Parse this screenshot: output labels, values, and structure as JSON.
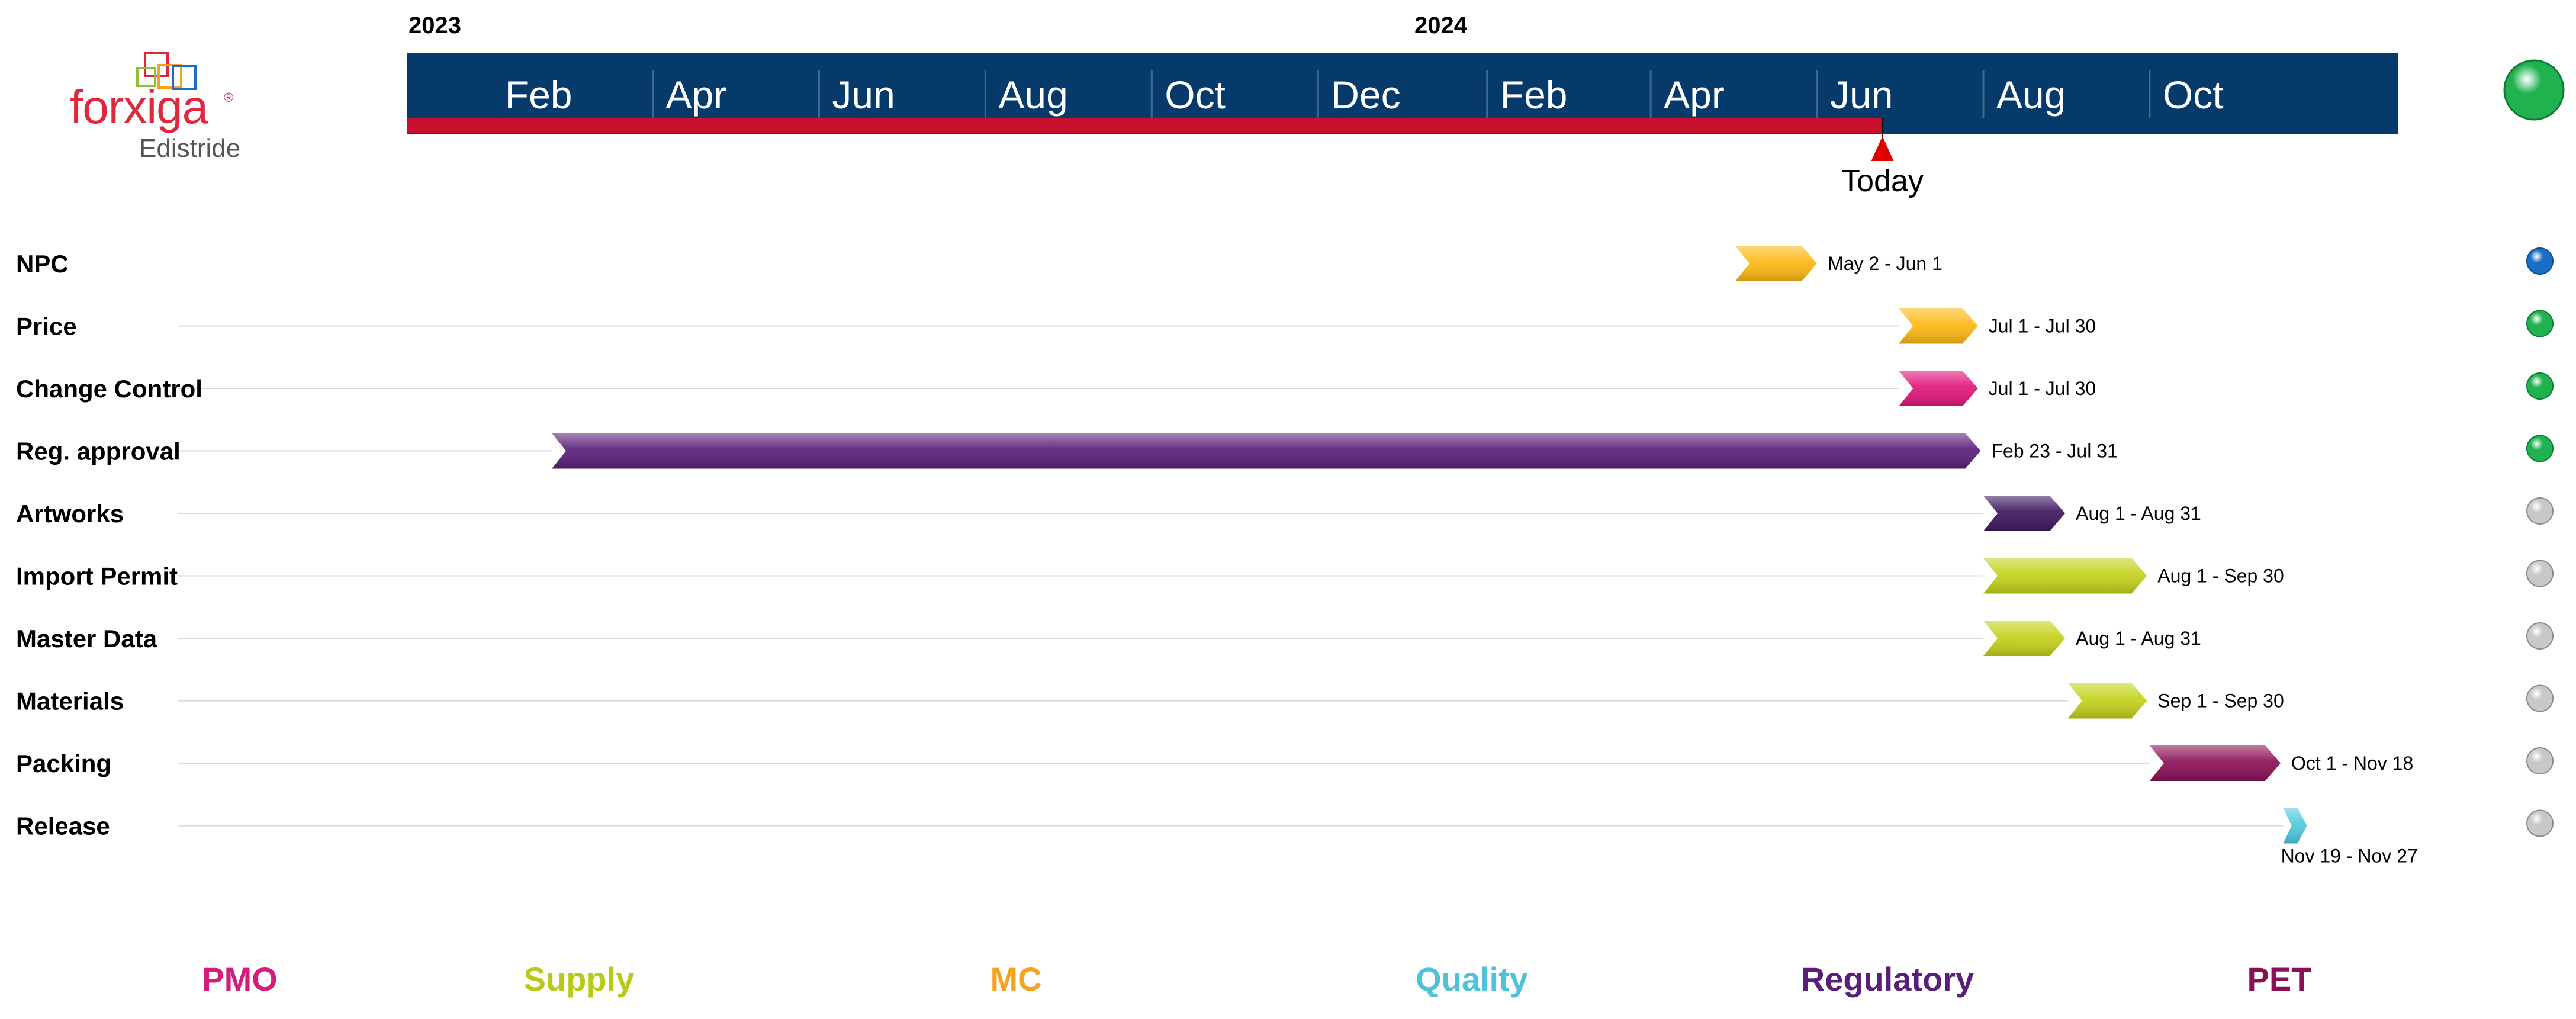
{
  "logo": {
    "name": "forxiga",
    "registered": "®",
    "subtitle": "Edistride"
  },
  "colors": {
    "timeline_band": "#063a6b",
    "progress_bar": "#c8102e",
    "today_marker": "#e00000",
    "gridline": "#d9d9d9"
  },
  "chart_data": {
    "type": "gantt",
    "years": [
      {
        "label": "2023",
        "date": "2023-01-01"
      },
      {
        "label": "2024",
        "date": "2024-01-01"
      }
    ],
    "axis": {
      "start": "2023-01-01",
      "end": "2024-12-31",
      "ticks": [
        {
          "label": "Feb",
          "date": "2023-02-01"
        },
        {
          "label": "Apr",
          "date": "2023-04-01"
        },
        {
          "label": "Jun",
          "date": "2023-06-01"
        },
        {
          "label": "Aug",
          "date": "2023-08-01"
        },
        {
          "label": "Oct",
          "date": "2023-10-01"
        },
        {
          "label": "Dec",
          "date": "2023-12-01"
        },
        {
          "label": "Feb",
          "date": "2024-02-01"
        },
        {
          "label": "Apr",
          "date": "2024-04-01"
        },
        {
          "label": "Jun",
          "date": "2024-06-01"
        },
        {
          "label": "Aug",
          "date": "2024-08-01"
        },
        {
          "label": "Oct",
          "date": "2024-10-01"
        }
      ]
    },
    "today": {
      "label": "Today",
      "date": "2024-06-25"
    },
    "tasks": [
      {
        "name": "NPC",
        "start": "2024-05-02",
        "end": "2024-06-01",
        "dates_label": "May 2 - Jun 1",
        "color": "#fdb913",
        "status_color": "#1a6fc4"
      },
      {
        "name": "Price",
        "start": "2024-07-01",
        "end": "2024-07-30",
        "dates_label": "Jul 1 - Jul 30",
        "color": "#fdb913",
        "status_color": "#1fb24f"
      },
      {
        "name": "Change Control",
        "start": "2024-07-01",
        "end": "2024-07-30",
        "dates_label": "Jul 1 - Jul 30",
        "color": "#e0157a",
        "status_color": "#1fb24f"
      },
      {
        "name": "Reg. approval",
        "start": "2023-02-23",
        "end": "2024-07-31",
        "dates_label": "Feb 23 - Jul 31",
        "color": "#5a1f7a",
        "status_color": "#1fb24f"
      },
      {
        "name": "Artworks",
        "start": "2024-08-01",
        "end": "2024-08-31",
        "dates_label": "Aug 1 - Aug 31",
        "color": "#3e1760",
        "status_color": "#c8c8c8"
      },
      {
        "name": "Import Permit",
        "start": "2024-08-01",
        "end": "2024-09-30",
        "dates_label": "Aug 1 - Sep 30",
        "color": "#c3d21a",
        "status_color": "#c8c8c8"
      },
      {
        "name": "Master Data",
        "start": "2024-08-01",
        "end": "2024-08-31",
        "dates_label": "Aug 1 - Aug 31",
        "color": "#c3d21a",
        "status_color": "#c8c8c8"
      },
      {
        "name": "Materials",
        "start": "2024-09-01",
        "end": "2024-09-30",
        "dates_label": "Sep 1 - Sep 30",
        "color": "#c3d21a",
        "status_color": "#c8c8c8"
      },
      {
        "name": "Packing",
        "start": "2024-10-01",
        "end": "2024-11-18",
        "dates_label": "Oct 1 - Nov 18",
        "color": "#8a1056",
        "status_color": "#c8c8c8"
      },
      {
        "name": "Release",
        "start": "2024-11-19",
        "end": "2024-11-27",
        "dates_label": "Nov 19 - Nov 27",
        "color": "#4fc9dd",
        "status_color": "#c8c8c8"
      }
    ],
    "overall_status_color": "#1fb24f",
    "legend": [
      {
        "label": "PMO",
        "color": "#d81b7a"
      },
      {
        "label": "Supply",
        "color": "#b8c918"
      },
      {
        "label": "MC",
        "color": "#f5a31a"
      },
      {
        "label": "Quality",
        "color": "#4ec3d8"
      },
      {
        "label": "Regulatory",
        "color": "#5a1f7a"
      },
      {
        "label": "PET",
        "color": "#8a1056"
      }
    ]
  }
}
